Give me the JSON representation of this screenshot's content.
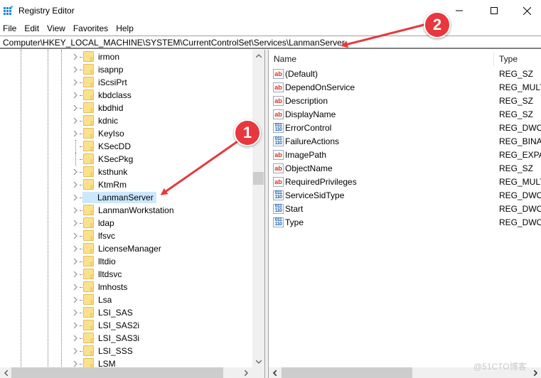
{
  "window": {
    "title": "Registry Editor",
    "controls": {
      "minimize": "minimize",
      "maximize": "maximize",
      "close": "close"
    }
  },
  "menu": [
    "File",
    "Edit",
    "View",
    "Favorites",
    "Help"
  ],
  "address": "Computer\\HKEY_LOCAL_MACHINE\\SYSTEM\\CurrentControlSet\\Services\\LanmanServer",
  "tree": {
    "items": [
      {
        "label": "irmon",
        "expandable": true
      },
      {
        "label": "isapnp",
        "expandable": true
      },
      {
        "label": "iScsiPrt",
        "expandable": true
      },
      {
        "label": "kbdclass",
        "expandable": true
      },
      {
        "label": "kbdhid",
        "expandable": true
      },
      {
        "label": "kdnic",
        "expandable": true
      },
      {
        "label": "KeyIso",
        "expandable": true
      },
      {
        "label": "KSecDD",
        "expandable": false
      },
      {
        "label": "KSecPkg",
        "expandable": false
      },
      {
        "label": "ksthunk",
        "expandable": true
      },
      {
        "label": "KtmRm",
        "expandable": true
      },
      {
        "label": "LanmanServer",
        "expandable": true,
        "selected": true
      },
      {
        "label": "LanmanWorkstation",
        "expandable": true
      },
      {
        "label": "ldap",
        "expandable": true
      },
      {
        "label": "lfsvc",
        "expandable": true
      },
      {
        "label": "LicenseManager",
        "expandable": true
      },
      {
        "label": "lltdio",
        "expandable": true
      },
      {
        "label": "lltdsvc",
        "expandable": true
      },
      {
        "label": "lmhosts",
        "expandable": true
      },
      {
        "label": "Lsa",
        "expandable": true
      },
      {
        "label": "LSI_SAS",
        "expandable": true
      },
      {
        "label": "LSI_SAS2i",
        "expandable": true
      },
      {
        "label": "LSI_SAS3i",
        "expandable": true
      },
      {
        "label": "LSI_SSS",
        "expandable": true
      },
      {
        "label": "LSM",
        "expandable": true
      }
    ]
  },
  "values": {
    "columns": {
      "name": "Name",
      "type": "Type"
    },
    "rows": [
      {
        "name": "(Default)",
        "type": "REG_SZ",
        "icon": "ab"
      },
      {
        "name": "DependOnService",
        "type": "REG_MULTI",
        "icon": "ab"
      },
      {
        "name": "Description",
        "type": "REG_SZ",
        "icon": "ab"
      },
      {
        "name": "DisplayName",
        "type": "REG_SZ",
        "icon": "ab"
      },
      {
        "name": "ErrorControl",
        "type": "REG_DWOR",
        "icon": "bin"
      },
      {
        "name": "FailureActions",
        "type": "REG_BINAR",
        "icon": "bin"
      },
      {
        "name": "ImagePath",
        "type": "REG_EXPAN",
        "icon": "ab"
      },
      {
        "name": "ObjectName",
        "type": "REG_SZ",
        "icon": "ab"
      },
      {
        "name": "RequiredPrivileges",
        "type": "REG_MULTI",
        "icon": "ab"
      },
      {
        "name": "ServiceSidType",
        "type": "REG_DWOR",
        "icon": "bin"
      },
      {
        "name": "Start",
        "type": "REG_DWOR",
        "icon": "bin"
      },
      {
        "name": "Type",
        "type": "REG_DWOR",
        "icon": "bin"
      }
    ]
  },
  "annotations": [
    {
      "number": "1",
      "target": "LanmanServer tree item"
    },
    {
      "number": "2",
      "target": "address bar"
    }
  ],
  "colors": {
    "annotation": "#e8383d",
    "selection": "#cce8ff"
  },
  "watermark": "@51CTO博客"
}
